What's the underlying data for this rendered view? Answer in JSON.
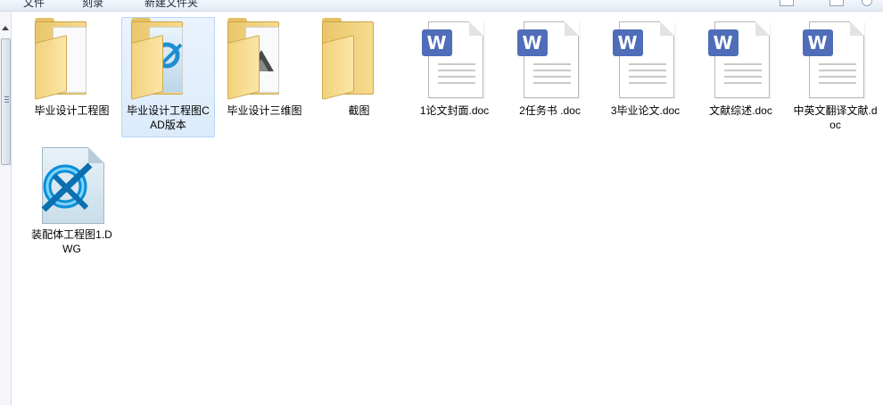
{
  "toolbar": {
    "items": [
      "文件",
      "刻录",
      "新建文件夹"
    ]
  },
  "files": [
    {
      "name": "毕业设计工程图",
      "type": "folder",
      "icon": "folder-icon",
      "selected": false
    },
    {
      "name": "毕业设计工程图CAD版本",
      "type": "folder",
      "icon": "folder-icon",
      "selected": true
    },
    {
      "name": "毕业设计三维图",
      "type": "folder",
      "icon": "folder-icon",
      "selected": false
    },
    {
      "name": "截图",
      "type": "folder",
      "icon": "folder-icon",
      "selected": false
    },
    {
      "name": "1论文封面.doc",
      "type": "doc",
      "icon": "word-doc-icon",
      "selected": false
    },
    {
      "name": "2任务书 .doc",
      "type": "doc",
      "icon": "word-doc-icon",
      "selected": false
    },
    {
      "name": "3毕业论文.doc",
      "type": "doc",
      "icon": "word-doc-icon",
      "selected": false
    },
    {
      "name": "文献综述.doc",
      "type": "doc",
      "icon": "word-doc-icon",
      "selected": false
    },
    {
      "name": "中英文翻译文献.doc",
      "type": "doc",
      "icon": "word-doc-icon",
      "selected": false
    },
    {
      "name": "装配体工程图1.DWG",
      "type": "dwg",
      "icon": "autocad-dwg-icon",
      "selected": false
    }
  ],
  "colors": {
    "selection_bg": "#dcebfc",
    "selection_border": "#b9d6f5",
    "word_badge": "#4f6db8",
    "folder": "#f6dc8f"
  },
  "doc_badge_letter": "W"
}
